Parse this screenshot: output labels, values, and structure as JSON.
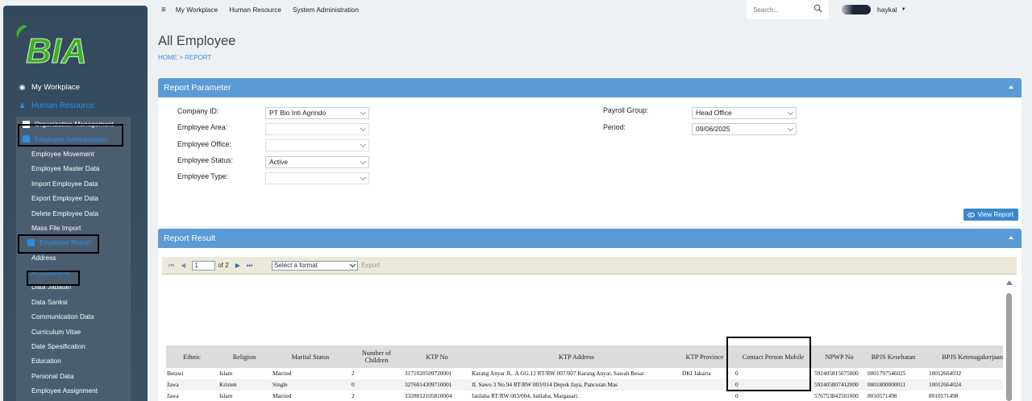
{
  "topnav": {
    "menu_icon": "menu-icon",
    "links": [
      "My Workplace",
      "Human Resource",
      "System Administration"
    ]
  },
  "search": {
    "placeholder": "Search...",
    "icon": "search-icon"
  },
  "user": {
    "name": "haykal"
  },
  "sidebar": {
    "logo_text": "BIA",
    "my_workplace": "My Workplace",
    "human_resource": "Human Resource",
    "organization_management": "Organization Management",
    "employee_administration": "Employee Administration",
    "admin_items": [
      "Employee Movement",
      "Employee Master Data",
      "Import Employee Data",
      "Export Employee Data",
      "Delete Employee Data",
      "Mass File Import"
    ],
    "employee_report": "Employee Report",
    "report_items": [
      "Address",
      "All Employee",
      "Data Jabatan",
      "Data Sanksi",
      "Communication Data",
      "Curriculum Vitae",
      "Date Spesification",
      "Education",
      "Personal Data",
      "Employee Assignment"
    ]
  },
  "page": {
    "title": "All Employee",
    "breadcrumb": "HOME > REPORT"
  },
  "report_parameter": {
    "title": "Report Parameter",
    "company_id_label": "Company ID:",
    "company_id_value": "PT Bio Inti Agrindo",
    "employee_area_label": "Employee Area:",
    "employee_area_value": "",
    "employee_office_label": "Employee Office:",
    "employee_office_value": "",
    "employee_status_label": "Employee Status:",
    "employee_status_value": "Active",
    "employee_type_label": "Employee Type:",
    "employee_type_value": "",
    "payroll_group_label": "Payroll Group:",
    "payroll_group_value": "Head Office",
    "period_label": "Period:",
    "period_value": "09/06/2025",
    "view_report_button": "View Report"
  },
  "report_result": {
    "title": "Report Result",
    "page_current": "1",
    "page_of": "of 2",
    "format_placeholder": "Select a format",
    "export_label": "Export"
  },
  "table": {
    "headers": [
      "Ethnic",
      "Religion",
      "Marital Status",
      "Number of Children",
      "KTP No",
      "KTP Address",
      "KTP Province",
      "Contact Person Mobile",
      "NPWP No",
      "BPJS Kesehatan",
      "BPJS Ketenagakerjaan"
    ],
    "rows": [
      [
        "Betawi",
        "Islam",
        "Married",
        "2",
        "3171020509720001",
        "Karang Anyar JL. A GG.12 RT/RW 007/007 Karang Anyar, Sawah Besar",
        "DKI Jakarta",
        "0",
        "592405815075000",
        "0001797546025",
        "10012664032"
      ],
      [
        "Jawa",
        "Kristen",
        "Single",
        "0",
        "3276014309710001",
        "Jl. Sawo 3 No.94 RT/RW 003/014 Depok Jaya, Pancoran Mas",
        "",
        "0",
        "592405807412000",
        "0001800000011",
        "10012664024"
      ],
      [
        "Jawa",
        "Islam",
        "Married",
        "2",
        "3328012105810004",
        "Jatilaba RT/RW 003/004, Jatilaba, Margasari.",
        "",
        "0",
        "576753842501000",
        "8010571498",
        "8010571498"
      ]
    ]
  },
  "colors": {
    "panel_header": "#5b9bd5",
    "sidebar_bg": "#334a5e",
    "accent_blue": "#2b8de6",
    "logo_green": "#3fae2a"
  }
}
